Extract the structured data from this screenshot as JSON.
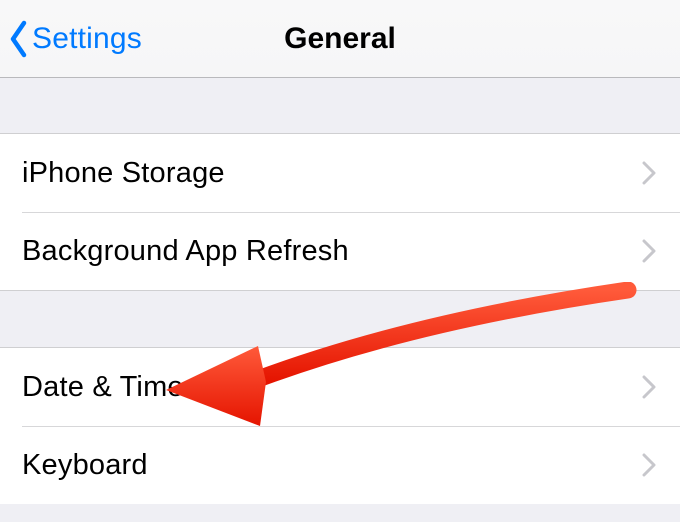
{
  "navbar": {
    "back_label": "Settings",
    "title": "General"
  },
  "group1": {
    "items": [
      {
        "label": "iPhone Storage"
      },
      {
        "label": "Background App Refresh"
      }
    ]
  },
  "group2": {
    "items": [
      {
        "label": "Date & Time"
      },
      {
        "label": "Keyboard"
      }
    ]
  },
  "annotation": {
    "target": "date-time-row",
    "color": "#ff2a12"
  }
}
